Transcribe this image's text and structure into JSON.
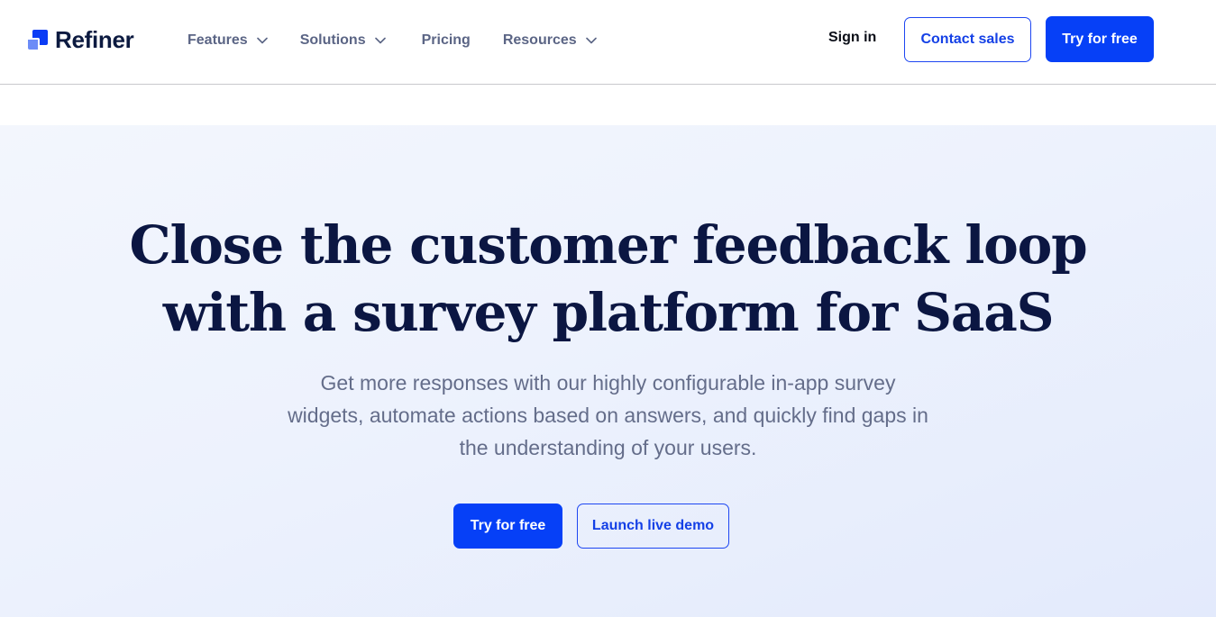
{
  "brand": {
    "name": "Refiner",
    "logo_icon": "refiner-squares-logo",
    "colors": {
      "primary": "#0640f7",
      "logo_dark": "#0c1a40",
      "heading": "#0b1642",
      "nav_text": "#5b6585",
      "body_text": "#646d8a"
    }
  },
  "header": {
    "nav": [
      {
        "label": "Features",
        "has_dropdown": true,
        "icon": "chevron-down-icon"
      },
      {
        "label": "Solutions",
        "has_dropdown": true,
        "icon": "chevron-down-icon"
      },
      {
        "label": "Pricing",
        "has_dropdown": false
      },
      {
        "label": "Resources",
        "has_dropdown": true,
        "icon": "chevron-down-icon"
      }
    ],
    "sign_in": "Sign in",
    "contact_sales": "Contact sales",
    "try_free": "Try for free"
  },
  "hero": {
    "title_lines": [
      "Close the customer feedback loop",
      "with a survey platform for SaaS"
    ],
    "subtitle_lines": [
      "Get more responses with our highly configurable in-app survey",
      "widgets, automate actions based on answers, and quickly find gaps in",
      "the understanding of your users."
    ],
    "primary_cta": "Try for free",
    "secondary_cta": "Launch live demo"
  }
}
